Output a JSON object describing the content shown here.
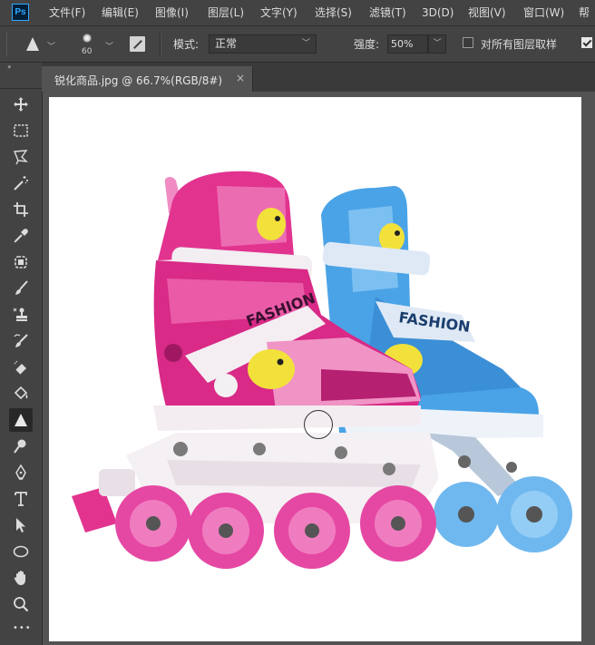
{
  "app": {
    "logo": "Ps"
  },
  "menu": [
    {
      "id": "file",
      "label": "文件(F)"
    },
    {
      "id": "edit",
      "label": "编辑(E)"
    },
    {
      "id": "image",
      "label": "图像(I)"
    },
    {
      "id": "layer",
      "label": "图层(L)"
    },
    {
      "id": "type",
      "label": "文字(Y)"
    },
    {
      "id": "select",
      "label": "选择(S)"
    },
    {
      "id": "filter",
      "label": "滤镜(T)"
    },
    {
      "id": "3d",
      "label": "3D(D)"
    },
    {
      "id": "view",
      "label": "视图(V)"
    },
    {
      "id": "window",
      "label": "窗口(W)"
    },
    {
      "id": "help",
      "label": "帮"
    }
  ],
  "options": {
    "tool_icon": "sharpen-icon",
    "brush_size": "60",
    "mode_label": "模式:",
    "mode_value": "正常",
    "strength_label": "强度:",
    "strength_value": "50%",
    "sample_all_layers_label": "对所有图层取样",
    "sample_all_layers_checked": false,
    "protect_detail_checked": true
  },
  "document": {
    "tab_title": "锐化商品.jpg @ 66.7%(RGB/8#)",
    "close_glyph": "×"
  },
  "canvas_art": {
    "skate_label": "FASHION"
  },
  "toolbar": {
    "collapse_glyph": "››",
    "more_glyph": "•••",
    "active_tool": "sharpen-tool"
  },
  "colors": {
    "ui_dark": "#434343",
    "workspace": "#535353",
    "pink_skate": "#e2338f",
    "blue_skate": "#4aa3e6"
  }
}
